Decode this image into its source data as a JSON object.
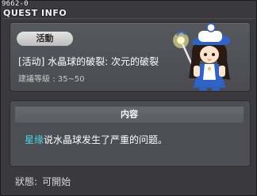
{
  "window": {
    "quest_id": "9662-0",
    "title": "QUEST INFO"
  },
  "quest": {
    "category": "活動",
    "name": "[活动] 水晶球的破裂: 次元的破裂",
    "level_label": "建議等級",
    "level_range": "35~50"
  },
  "content": {
    "header": "内容",
    "npc_name": "星缘",
    "text": "说水晶球发生了严重的问题。"
  },
  "status": {
    "label": "狀態",
    "value": "可開始"
  }
}
